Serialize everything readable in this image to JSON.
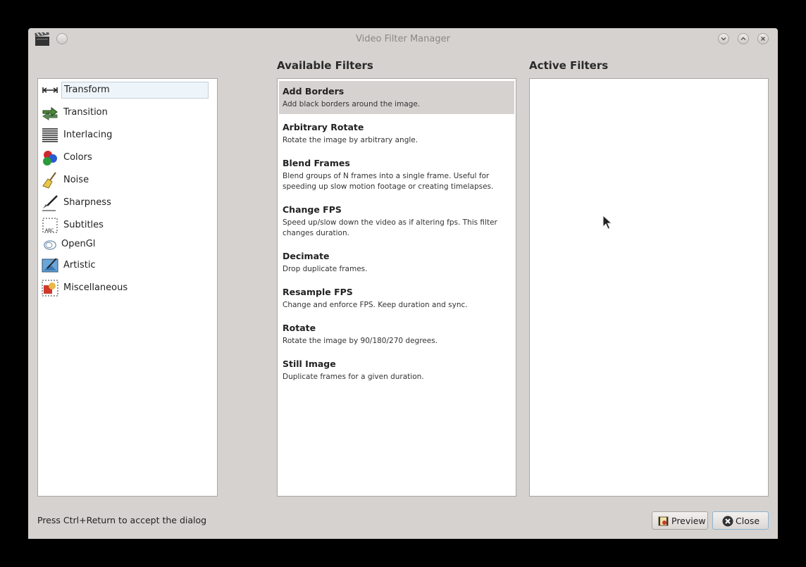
{
  "window": {
    "title": "Video Filter Manager"
  },
  "categories": [
    {
      "label": "Transform",
      "icon": "transform-icon",
      "selected": true
    },
    {
      "label": "Transition",
      "icon": "transition-icon"
    },
    {
      "label": "Interlacing",
      "icon": "interlacing-icon"
    },
    {
      "label": "Colors",
      "icon": "colors-icon"
    },
    {
      "label": "Noise",
      "icon": "noise-icon"
    },
    {
      "label": "Sharpness",
      "icon": "sharpness-icon"
    },
    {
      "label": "Subtitles",
      "icon": "subtitles-icon"
    },
    {
      "label": "OpenGl",
      "icon": "opengl-icon"
    },
    {
      "label": "Artistic",
      "icon": "artistic-icon"
    },
    {
      "label": "Miscellaneous",
      "icon": "miscellaneous-icon"
    }
  ],
  "available": {
    "header": "Available Filters",
    "filters": [
      {
        "name": "Add Borders",
        "desc": "Add black borders around the image.",
        "selected": true
      },
      {
        "name": "Arbitrary Rotate",
        "desc": "Rotate the image by arbitrary angle."
      },
      {
        "name": "Blend Frames",
        "desc": "Blend groups of N frames into a single frame.  Useful for speeding up slow motion footage or creating timelapses."
      },
      {
        "name": "Change FPS",
        "desc": "Speed up/slow down the video as if altering fps. This filter changes duration."
      },
      {
        "name": "Decimate",
        "desc": "Drop duplicate frames."
      },
      {
        "name": "Resample FPS",
        "desc": "Change and enforce FPS. Keep duration and sync."
      },
      {
        "name": "Rotate",
        "desc": "Rotate the image by 90/180/270 degrees."
      },
      {
        "name": "Still Image",
        "desc": "Duplicate frames for a given duration."
      }
    ]
  },
  "active": {
    "header": "Active Filters",
    "filters": []
  },
  "footer": {
    "status": "Press Ctrl+Return to accept the dialog",
    "preview_label": "Preview",
    "close_label": "Close"
  }
}
